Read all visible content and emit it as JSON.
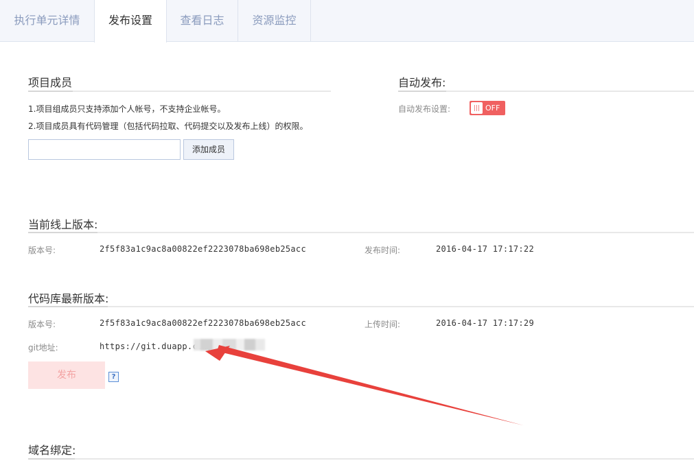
{
  "tabs": [
    {
      "label": "执行单元详情",
      "active": false
    },
    {
      "label": "发布设置",
      "active": true
    },
    {
      "label": "查看日志",
      "active": false
    },
    {
      "label": "资源监控",
      "active": false
    }
  ],
  "members": {
    "title": "项目成员",
    "note1": "1.项目组成员只支持添加个人帐号，不支持企业帐号。",
    "note2": "2.项目成员具有代码管理（包括代码拉取、代码提交以及发布上线）的权限。",
    "input_value": "",
    "add_button": "添加成员"
  },
  "auto_publish": {
    "title": "自动发布:",
    "setting_label": "自动发布设置:",
    "toggle_text": "OFF",
    "enabled": false
  },
  "current_version": {
    "title": "当前线上版本:",
    "version_label": "版本号:",
    "version": "2f5f83a1c9ac8a00822ef2223078ba698eb25acc",
    "time_label": "发布时间:",
    "time": "2016-04-17 17:17:22"
  },
  "latest_version": {
    "title": "代码库最新版本:",
    "version_label": "版本号:",
    "version": "2f5f83a1c9ac8a00822ef2223078ba698eb25acc",
    "time_label": "上传时间:",
    "time": "2016-04-17 17:17:29",
    "git_label": "git地址:",
    "git_url": "https://git.duapp.com/",
    "publish_button": "发布",
    "help": "?"
  },
  "domain": {
    "title": "域名绑定:"
  },
  "colors": {
    "accent_red": "#f06060",
    "arrow_red": "#e8413c",
    "tab_inactive": "#8a9bbd",
    "publish_disabled_bg": "#fde3e3"
  }
}
